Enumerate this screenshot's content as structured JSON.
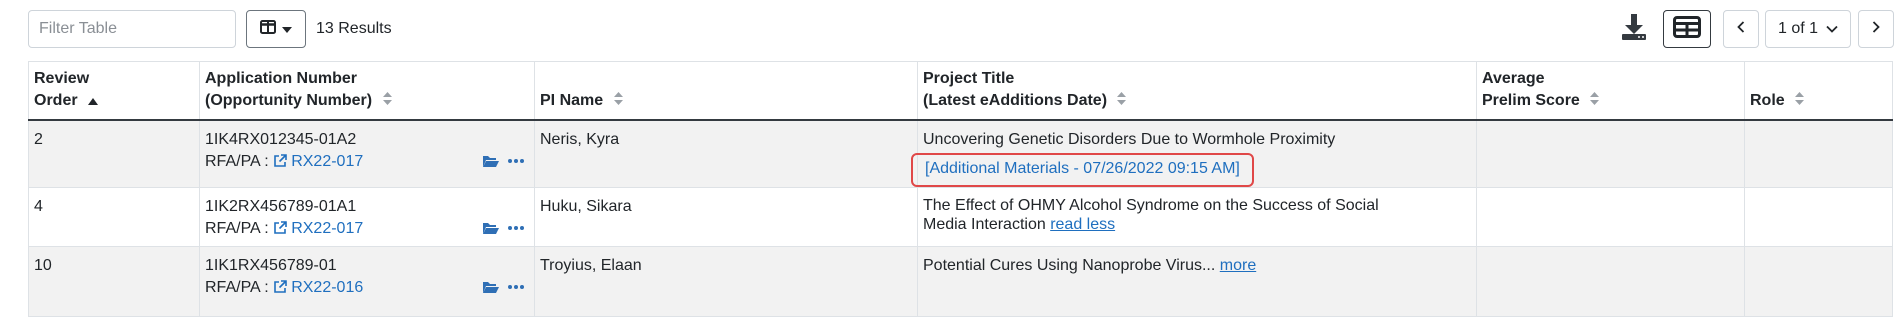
{
  "toolbar": {
    "filter_placeholder": "Filter Table",
    "results_text": "13 Results",
    "pagination": {
      "current_label": "1 of 1"
    }
  },
  "table": {
    "headers": {
      "review_order": [
        "Review",
        "Order"
      ],
      "application_number": [
        "Application Number",
        "(Opportunity Number)"
      ],
      "pi_name": "PI Name",
      "project_title": [
        "Project Title",
        "(Latest eAdditions Date)"
      ],
      "average_prelim_score": [
        "Average",
        "Prelim Score"
      ],
      "role": "Role"
    },
    "rows": [
      {
        "review_order": "2",
        "application_number": "1IK4RX012345-01A2",
        "rfa_label": "RFA/PA :",
        "rfa_number": "RX22-017",
        "pi_name": "Neris, Kyra",
        "project_title": "Uncovering Genetic Disorders Due to Wormhole Proximity",
        "additional_materials": "[Additional Materials - 07/26/2022 09:15 AM]",
        "average_prelim_score": "",
        "role": ""
      },
      {
        "review_order": "4",
        "application_number": "1IK2RX456789-01A1",
        "rfa_label": "RFA/PA :",
        "rfa_number": "RX22-017",
        "pi_name": "Huku, Sikara",
        "project_title_line1": "The Effect of OHMY Alcohol Syndrome on the Success of Social",
        "project_title_line2": "Media Interaction",
        "toggle_label": "read less",
        "average_prelim_score": "",
        "role": ""
      },
      {
        "review_order": "10",
        "application_number": "1IK1RX456789-01",
        "rfa_label": "RFA/PA :",
        "rfa_number": "RX22-016",
        "pi_name": "Troyius, Elaan",
        "project_title": "Potential Cures Using Nanoprobe Virus...",
        "toggle_label": "more",
        "average_prelim_score": "",
        "role": ""
      }
    ]
  },
  "colors": {
    "link": "#1f6fbf",
    "highlight_border": "#e04848",
    "row_shade": "#f2f2f2",
    "icon_dark": "#343a40"
  }
}
